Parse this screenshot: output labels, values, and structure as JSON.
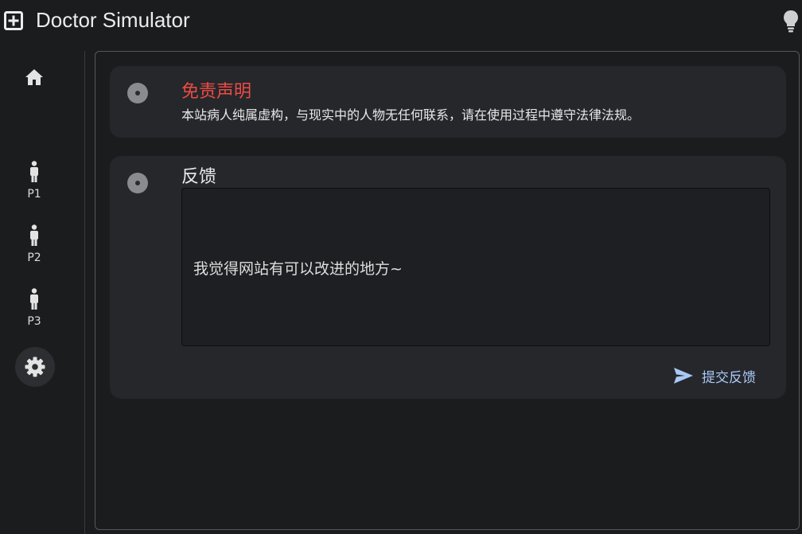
{
  "app": {
    "title": "Doctor Simulator"
  },
  "sidebar": {
    "items": [
      {
        "icon": "home-icon",
        "label": ""
      },
      {
        "icon": "person-icon",
        "label": "P1"
      },
      {
        "icon": "person-icon",
        "label": "P2"
      },
      {
        "icon": "person-icon",
        "label": "P3"
      },
      {
        "icon": "settings-icon",
        "label": ""
      }
    ]
  },
  "disclaimer": {
    "title": "免责声明",
    "text": "本站病人纯属虚构，与现实中的人物无任何联系，请在使用过程中遵守法律法规。",
    "title_color": "#ee4b45"
  },
  "feedback": {
    "title": "反馈",
    "value": "我觉得网站有可以改进的地方~",
    "submit_label": "提交反馈",
    "accent_color": "#a9c8f5"
  }
}
